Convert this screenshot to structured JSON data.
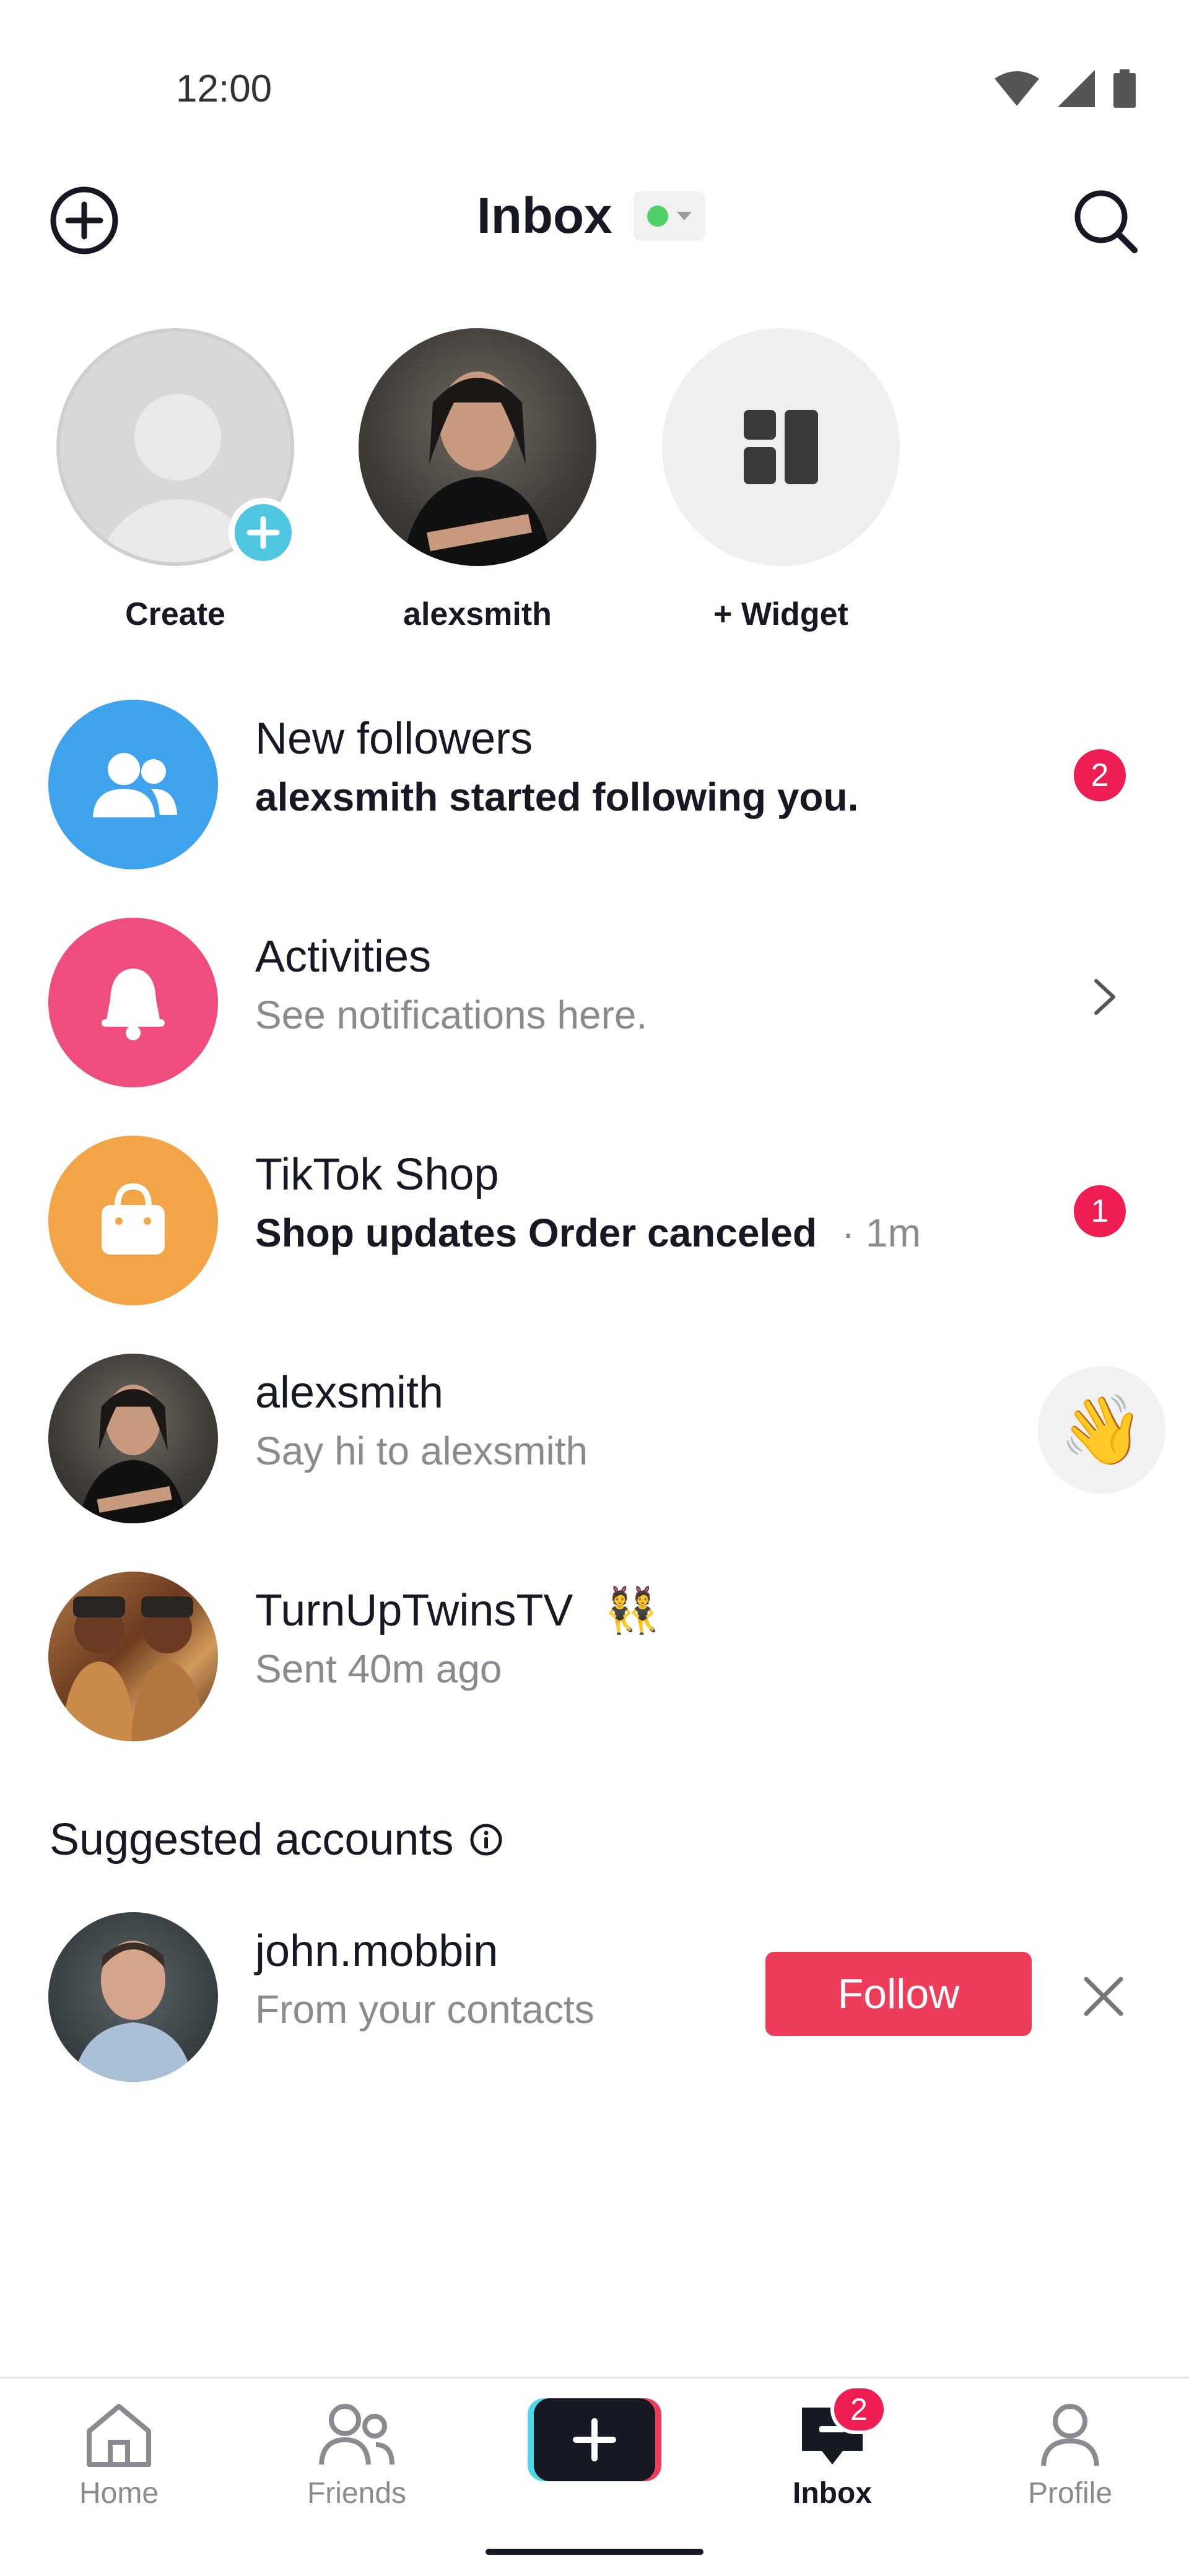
{
  "status_bar": {
    "time": "12:00"
  },
  "header": {
    "title": "Inbox"
  },
  "stories": [
    {
      "label": "Create"
    },
    {
      "label": "alexsmith"
    },
    {
      "label": "+ Widget"
    }
  ],
  "rows": [
    {
      "title": "New followers",
      "subtitle": "alexsmith started following you.",
      "badge": "2"
    },
    {
      "title": "Activities",
      "subtitle": "See notifications here."
    },
    {
      "title": "TikTok Shop",
      "subtitle": "Shop updates Order canceled",
      "time": "· 1m",
      "badge": "1"
    },
    {
      "title": "alexsmith",
      "subtitle": "Say hi to alexsmith"
    },
    {
      "title": "TurnUpTwinsTV",
      "emoji": "👯",
      "subtitle": "Sent 40m ago"
    }
  ],
  "suggested": {
    "title": "Suggested accounts",
    "accounts": [
      {
        "name": "john.mobbin",
        "subtitle": "From your contacts",
        "follow_label": "Follow"
      }
    ]
  },
  "wave_emoji": "👋",
  "bottom_nav": {
    "items": [
      {
        "label": "Home"
      },
      {
        "label": "Friends"
      },
      {
        "label": "Inbox",
        "badge": "2"
      },
      {
        "label": "Profile"
      }
    ]
  },
  "colors": {
    "followers_blue": "#3fa2ec",
    "activities_pink": "#ee4d7e",
    "shop_orange": "#f3a447",
    "accent_red": "#ee1d52",
    "online_green": "#4fd06a"
  },
  "icons": [
    "plus-circle-icon",
    "search-icon",
    "people-icon",
    "bell-icon",
    "shopping-bag-icon",
    "chevron-right-icon",
    "info-icon",
    "close-icon",
    "home-icon",
    "friends-icon",
    "inbox-icon",
    "profile-icon",
    "widget-icon"
  ]
}
